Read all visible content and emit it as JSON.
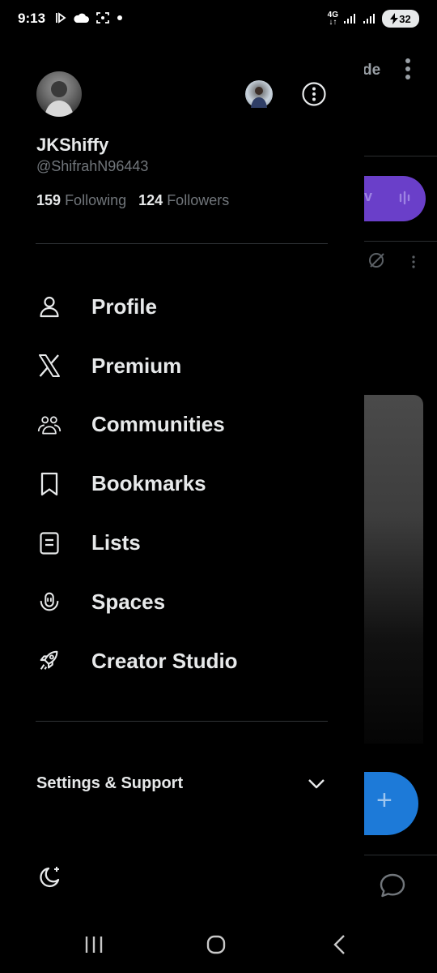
{
  "status_bar": {
    "time": "9:13",
    "network": "4G",
    "battery": "32"
  },
  "drawer": {
    "username": "JKShiffy",
    "handle": "@ShifrahN96443",
    "following_count": "159",
    "following_label": "Following",
    "followers_count": "124",
    "followers_label": "Followers",
    "menu": [
      {
        "label": "Profile",
        "icon": "person-icon"
      },
      {
        "label": "Premium",
        "icon": "x-logo-icon"
      },
      {
        "label": "Communities",
        "icon": "communities-icon"
      },
      {
        "label": "Bookmarks",
        "icon": "bookmark-icon"
      },
      {
        "label": "Lists",
        "icon": "list-icon"
      },
      {
        "label": "Spaces",
        "icon": "spaces-microphone-icon"
      },
      {
        "label": "Creator Studio",
        "icon": "rocket-icon"
      }
    ],
    "settings_label": "Settings & Support"
  },
  "background_app": {
    "title_fragment": "de",
    "pill_fragment": "v"
  },
  "colors": {
    "background": "#000000",
    "text_primary": "#e7e9ea",
    "text_secondary": "#71767b",
    "divider": "#2f3336",
    "fab_blue": "#1d7ad8",
    "spaces_purple": "#6a3fc9"
  }
}
